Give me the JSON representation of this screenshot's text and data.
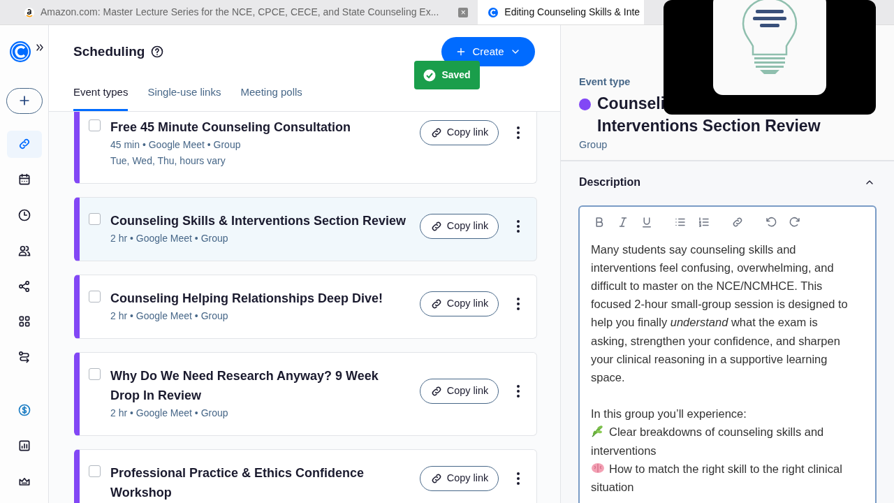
{
  "browser_tabs": [
    {
      "title": "Amazon.com: Master Lecture Series for the NCE, CPCE, CECE, and State Counseling Ex...",
      "close": "×",
      "selected": false
    },
    {
      "title": "Editing Counseling Skills & Inte",
      "selected": true
    }
  ],
  "sidebar": {
    "items": [
      {
        "kind": "create",
        "selected": false
      },
      {
        "kind": "link",
        "selected": true
      },
      {
        "kind": "calendar",
        "selected": false
      },
      {
        "kind": "clock",
        "selected": false
      },
      {
        "kind": "people",
        "selected": false
      },
      {
        "kind": "nodes",
        "selected": false
      },
      {
        "kind": "grid",
        "selected": false
      },
      {
        "kind": "route",
        "selected": false
      },
      {
        "kind": "dollar",
        "selected": false
      },
      {
        "kind": "chart",
        "selected": false
      },
      {
        "kind": "crown",
        "selected": false
      }
    ]
  },
  "header": {
    "title": "Scheduling",
    "create_button": "Create"
  },
  "toast": {
    "text": "Saved"
  },
  "tabs": [
    {
      "label": "Event types",
      "selected": true
    },
    {
      "label": "Single-use links",
      "selected": false
    },
    {
      "label": "Meeting polls",
      "selected": false
    }
  ],
  "event_types": [
    {
      "title": "Free 45 Minute Counseling Consultation",
      "details": [
        "45 min • Google Meet • Group",
        "Tue, Wed, Thu, hours vary"
      ],
      "checked": false,
      "highlighted": false,
      "button": "Copy link"
    },
    {
      "title": "Counseling Skills & Interventions Section Review",
      "details": [
        "2 hr • Google Meet • Group"
      ],
      "checked": false,
      "highlighted": true,
      "button": "Copy link"
    },
    {
      "title": "Counseling Helping Relationships Deep Dive!",
      "details": [
        "2 hr • Google Meet • Group"
      ],
      "checked": false,
      "highlighted": false,
      "button": "Copy link"
    },
    {
      "title": "Why Do We Need Research Anyway? 9 Week Drop In Review",
      "details": [
        "2 hr • Google Meet • Group"
      ],
      "checked": false,
      "highlighted": false,
      "button": "Copy link"
    },
    {
      "title": "Professional Practice & Ethics Confidence Workshop",
      "checked": false,
      "highlighted": false,
      "button": "Copy link"
    }
  ],
  "panel": {
    "label": "Event type",
    "title_visible": [
      "Counseli",
      "Interventions Section Review"
    ],
    "subtitle": "Group",
    "description": {
      "heading": "Description",
      "expanded": true,
      "paragraph": "Many students say counseling skills and interventions feel confusing, overwhelming, and difficult to master on the NCE/NCMHCE. This focused 2-hour small-group session is designed to help you finally *understand* what the exam is asking, strengthen your confidence, and sharpen your clinical reasoning in a supportive learning space.",
      "intro": "In this group you’ll experience:",
      "points": [
        {
          "kind": "leaf",
          "text": "Clear breakdowns of counseling skills and interventions"
        },
        {
          "kind": "brain",
          "text": "How to match the right skill to the right clinical situation"
        }
      ]
    }
  }
}
